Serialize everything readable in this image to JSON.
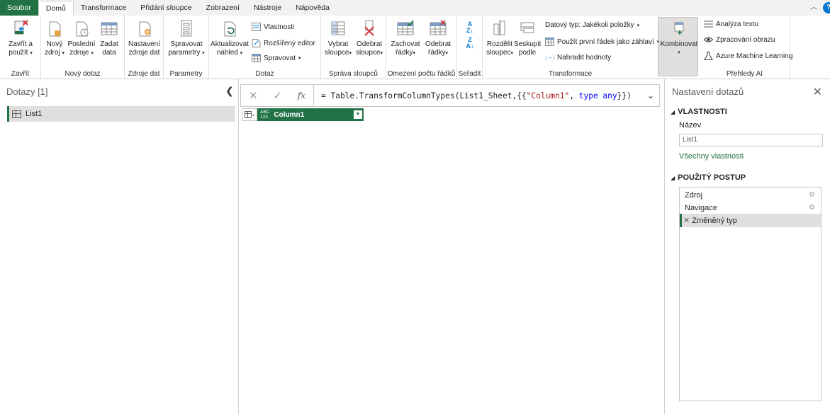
{
  "tabs": [
    "Soubor",
    "Domů",
    "Transformace",
    "Přidání sloupce",
    "Zobrazení",
    "Nástroje",
    "Nápověda"
  ],
  "help_label": "?",
  "ribbon": {
    "groups": {
      "close": "Zavřít",
      "new_query": "Nový dotaz",
      "data_sources": "Zdroje dat",
      "parameters": "Parametry",
      "query": "Dotaz",
      "manage_columns": "Správa sloupců",
      "reduce_rows": "Omezení počtu řádků",
      "sort": "Seřadit",
      "transform": "Transformace",
      "ai": "Přehledy AI"
    },
    "close_apply": [
      "Zavřít a",
      "použít"
    ],
    "new_source": [
      "Nový",
      "zdroj"
    ],
    "recent_sources": [
      "Poslední",
      "zdroje"
    ],
    "enter_data": [
      "Zadat",
      "data"
    ],
    "data_source_settings": [
      "Nastavení",
      "zdroje dat"
    ],
    "manage_parameters": [
      "Spravovat",
      "parametry"
    ],
    "refresh_preview": [
      "Aktualizovat",
      "náhled"
    ],
    "properties": "Vlastnosti",
    "advanced_editor": "Rozšířený editor",
    "manage": "Spravovat",
    "choose_columns": [
      "Vybrat",
      "sloupce"
    ],
    "remove_columns": [
      "Odebrat",
      "sloupce"
    ],
    "keep_rows": [
      "Zachovat",
      "řádky"
    ],
    "remove_rows": [
      "Odebrat",
      "řádky"
    ],
    "split_column": [
      "Rozdělit",
      "sloupec"
    ],
    "group_by": [
      "Seskupit",
      "podle"
    ],
    "data_type": "Datový typ: Jakékoli položky",
    "first_row_headers": "Použít první řádek jako záhlaví",
    "replace_values": "Nahradit hodnoty",
    "combine": "Kombinovat",
    "text_analytics": "Analýza textu",
    "vision": "Zpracování obrazu",
    "azure_ml": "Azure Machine Learning"
  },
  "left_panel": {
    "title": "Dotazy [1]",
    "queries": [
      "List1"
    ]
  },
  "formula": {
    "prefix": "= Table.TransformColumnTypes(List1_Sheet,{{",
    "str": "\"Column1\"",
    "mid": ", ",
    "kw": "type any",
    "suffix": "}})"
  },
  "grid": {
    "type_badge_top": "ABC",
    "type_badge_bottom": "123",
    "column": "Column1"
  },
  "right_panel": {
    "title": "Nastavení dotazů",
    "properties_header": "VLASTNOSTI",
    "name_label": "Název",
    "name_value": "List1",
    "all_properties": "Všechny vlastnosti",
    "steps_header": "POUŽITÝ POSTUP",
    "steps": [
      "Zdroj",
      "Navigace",
      "Změněný typ"
    ]
  },
  "colors": {
    "accent": "#217346",
    "file_tab": "#217346",
    "help": "#0078d4"
  }
}
